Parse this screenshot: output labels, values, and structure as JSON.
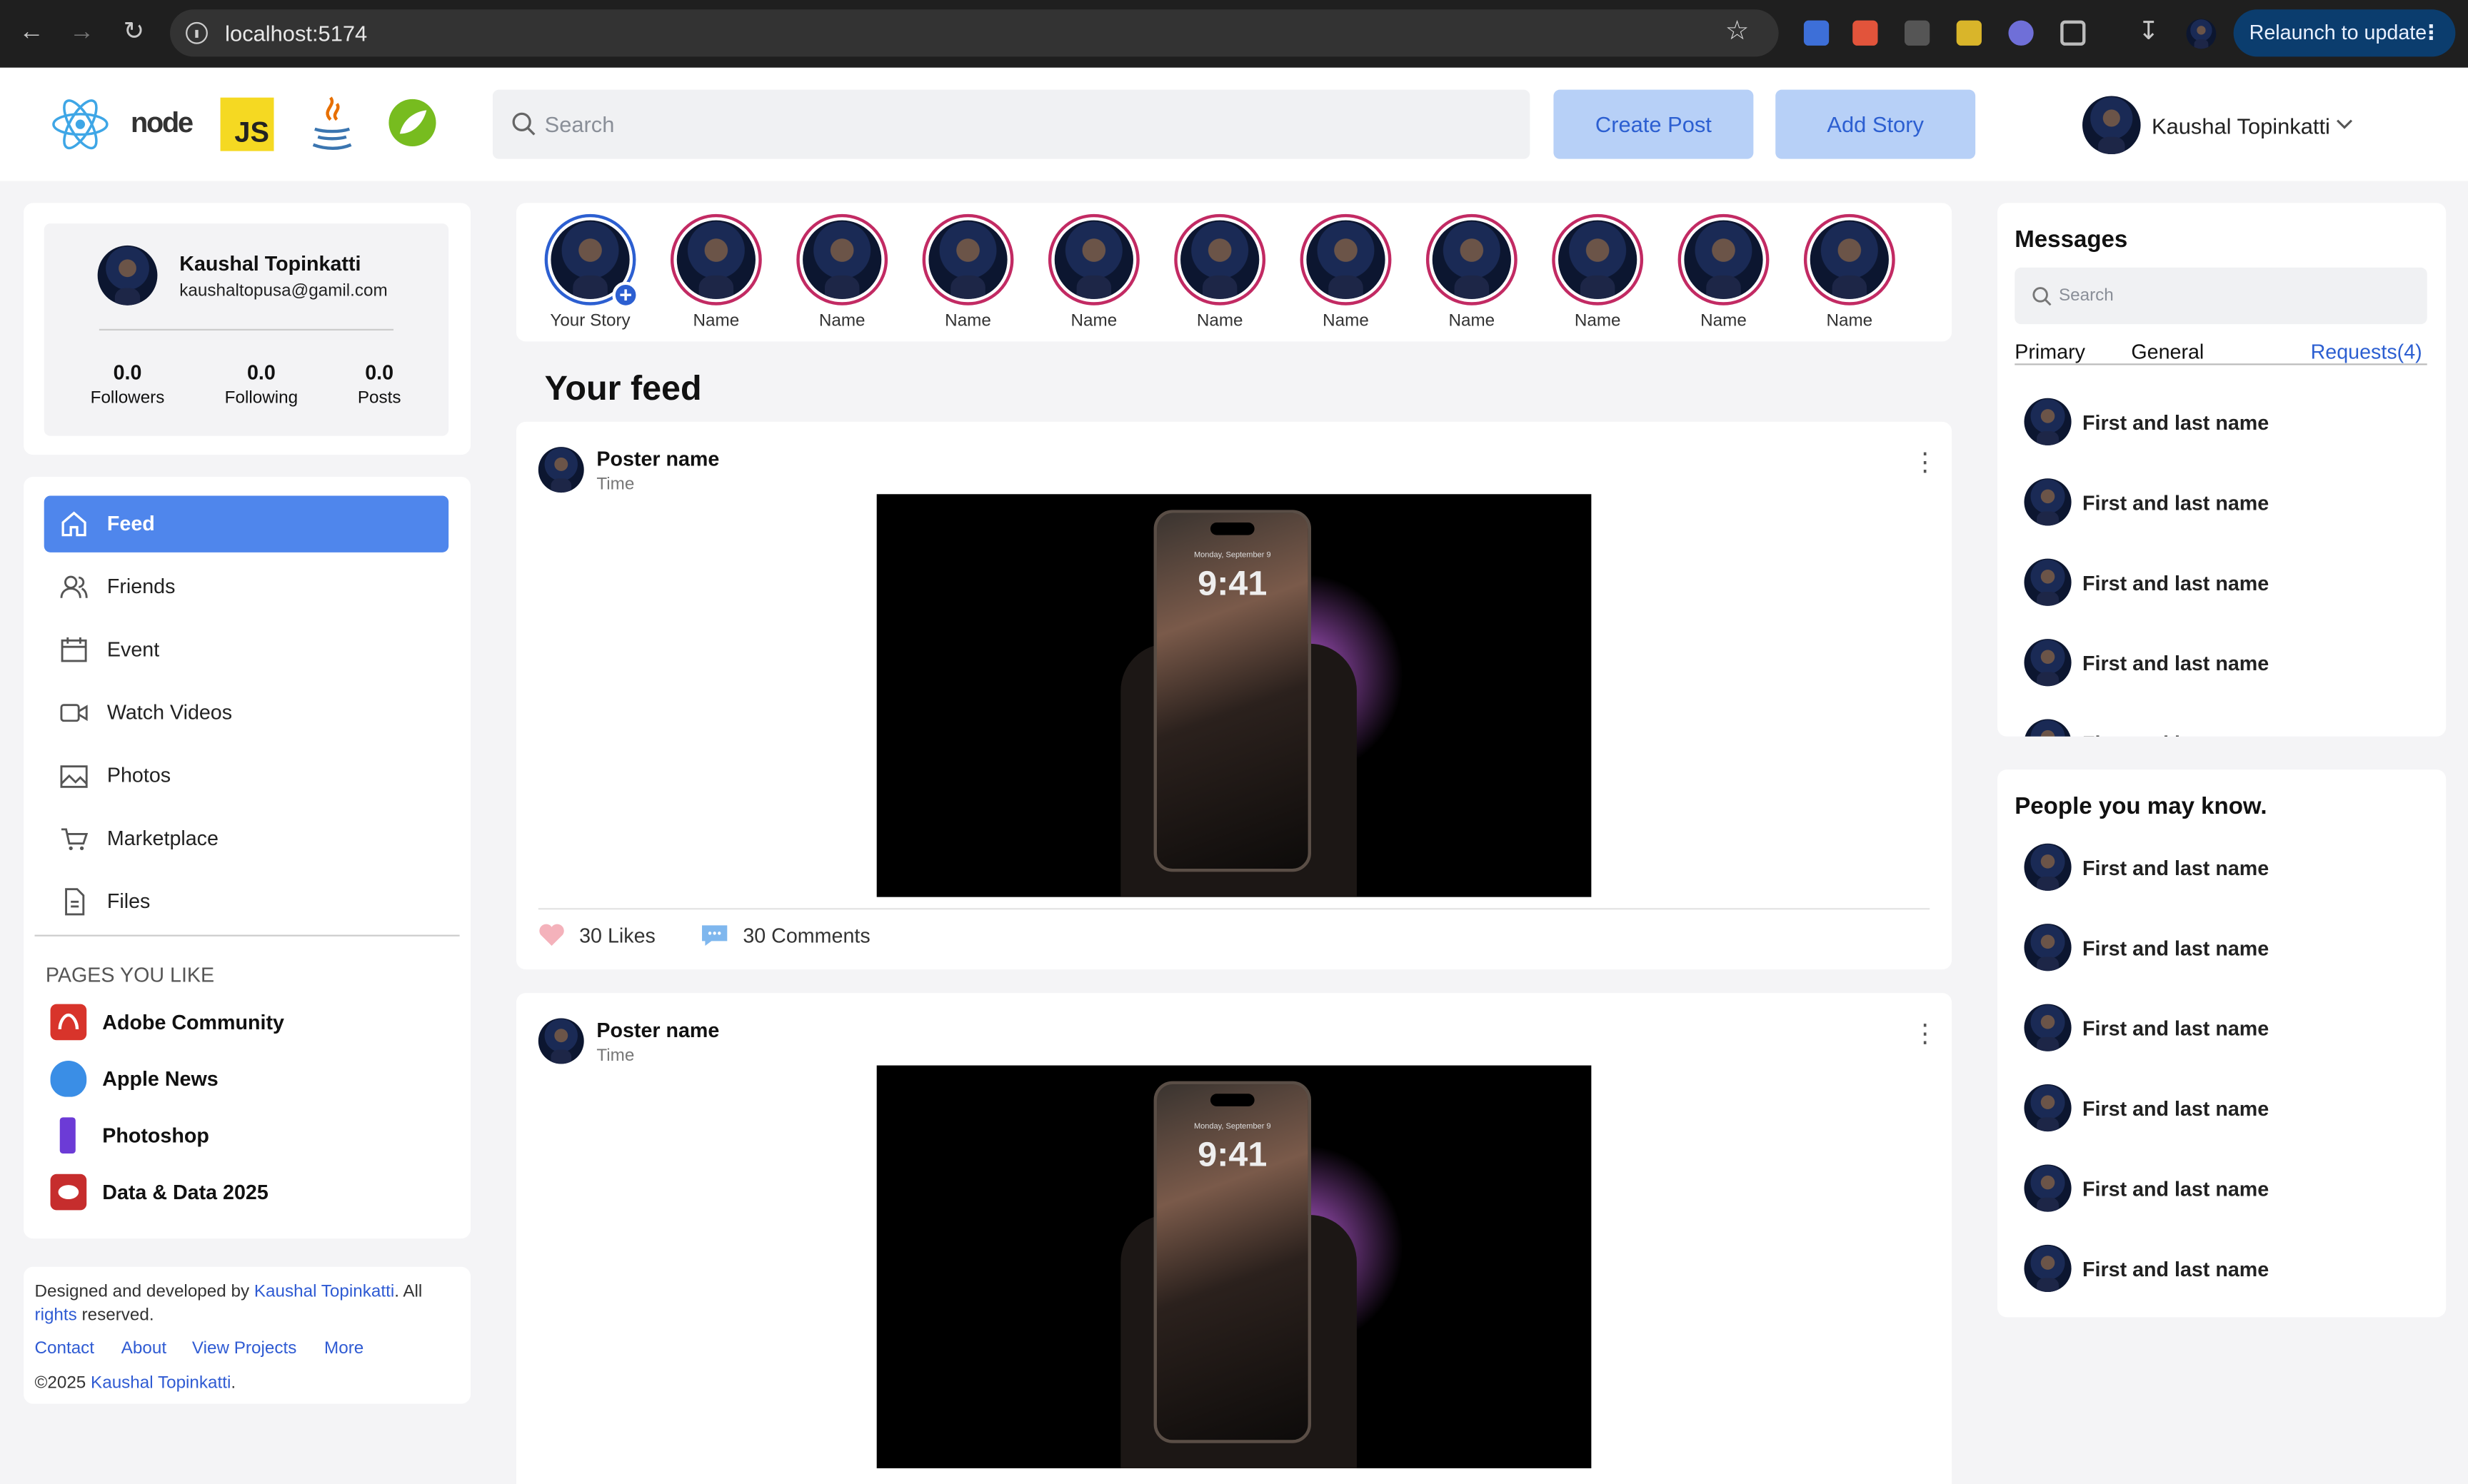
{
  "browser": {
    "url": "localhost:5174",
    "relaunch_label": "Relaunch to update"
  },
  "header": {
    "logos": [
      "react-logo",
      "node-logo",
      "js-logo",
      "java-logo",
      "spring-logo"
    ],
    "logo_node_text": "node",
    "logo_js_text": "JS",
    "search_placeholder": "Search",
    "create_post_label": "Create Post",
    "add_story_label": "Add Story",
    "user_name": "Kaushal Topinkatti"
  },
  "profile": {
    "name": "Kaushal Topinkatti",
    "email": "kaushaltopusa@gamil.com",
    "stats": [
      {
        "value": "0.0",
        "label": "Followers"
      },
      {
        "value": "0.0",
        "label": "Following"
      },
      {
        "value": "0.0",
        "label": "Posts"
      }
    ]
  },
  "sidebar": {
    "items": [
      {
        "label": "Feed",
        "icon": "home-icon",
        "active": true
      },
      {
        "label": "Friends",
        "icon": "friends-icon"
      },
      {
        "label": "Event",
        "icon": "calendar-icon"
      },
      {
        "label": "Watch Videos",
        "icon": "video-icon"
      },
      {
        "label": "Photos",
        "icon": "photos-icon"
      },
      {
        "label": "Marketplace",
        "icon": "cart-icon"
      },
      {
        "label": "Files",
        "icon": "files-icon"
      }
    ],
    "pages_heading": "PAGES YOU LIKE",
    "pages": [
      {
        "label": "Adobe Community",
        "color": "#d8342b"
      },
      {
        "label": "Apple News",
        "color": "#3a8ee6"
      },
      {
        "label": "Photoshop",
        "color": "#6c3bd6"
      },
      {
        "label": "Data & Data 2025",
        "color": "#c62d2d"
      }
    ]
  },
  "footer": {
    "designed_prefix": "Designed and developed by",
    "author": "Kaushal Topinkatti",
    "all": ". All",
    "rights": "rights",
    "reserved": "reserved.",
    "links": [
      "Contact",
      "About",
      "View Projects",
      "More"
    ],
    "copyright_prefix": "©2025",
    "copyright_suffix": "."
  },
  "stories": {
    "your_story": "Your Story",
    "names": [
      "Name",
      "Name",
      "Name",
      "Name",
      "Name",
      "Name",
      "Name",
      "Name",
      "Name",
      "Name"
    ]
  },
  "feed": {
    "title": "Your feed",
    "posts": [
      {
        "poster": "Poster name",
        "time": "Time",
        "likes": "30 Likes",
        "comments": "30 Comments",
        "image_date": "Monday, September 9",
        "image_time": "9:41"
      },
      {
        "poster": "Poster name",
        "time": "Time",
        "image_date": "Monday, September 9",
        "image_time": "9:41"
      }
    ]
  },
  "messages": {
    "title": "Messages",
    "search_placeholder": "Search",
    "tabs": [
      "Primary",
      "General"
    ],
    "requests": "Requests(4)",
    "contacts": [
      "First and last name",
      "First and last name",
      "First and last name",
      "First and last name",
      "First and last name"
    ]
  },
  "people": {
    "title": "People you may know.",
    "names": [
      "First and last name",
      "First and last name",
      "First and last name",
      "First and last name",
      "First and last name",
      "First and last name"
    ]
  },
  "colors": {
    "accent": "#4f86ec",
    "button_bg": "#b7d0f7",
    "story_ring": "#c22a63"
  }
}
